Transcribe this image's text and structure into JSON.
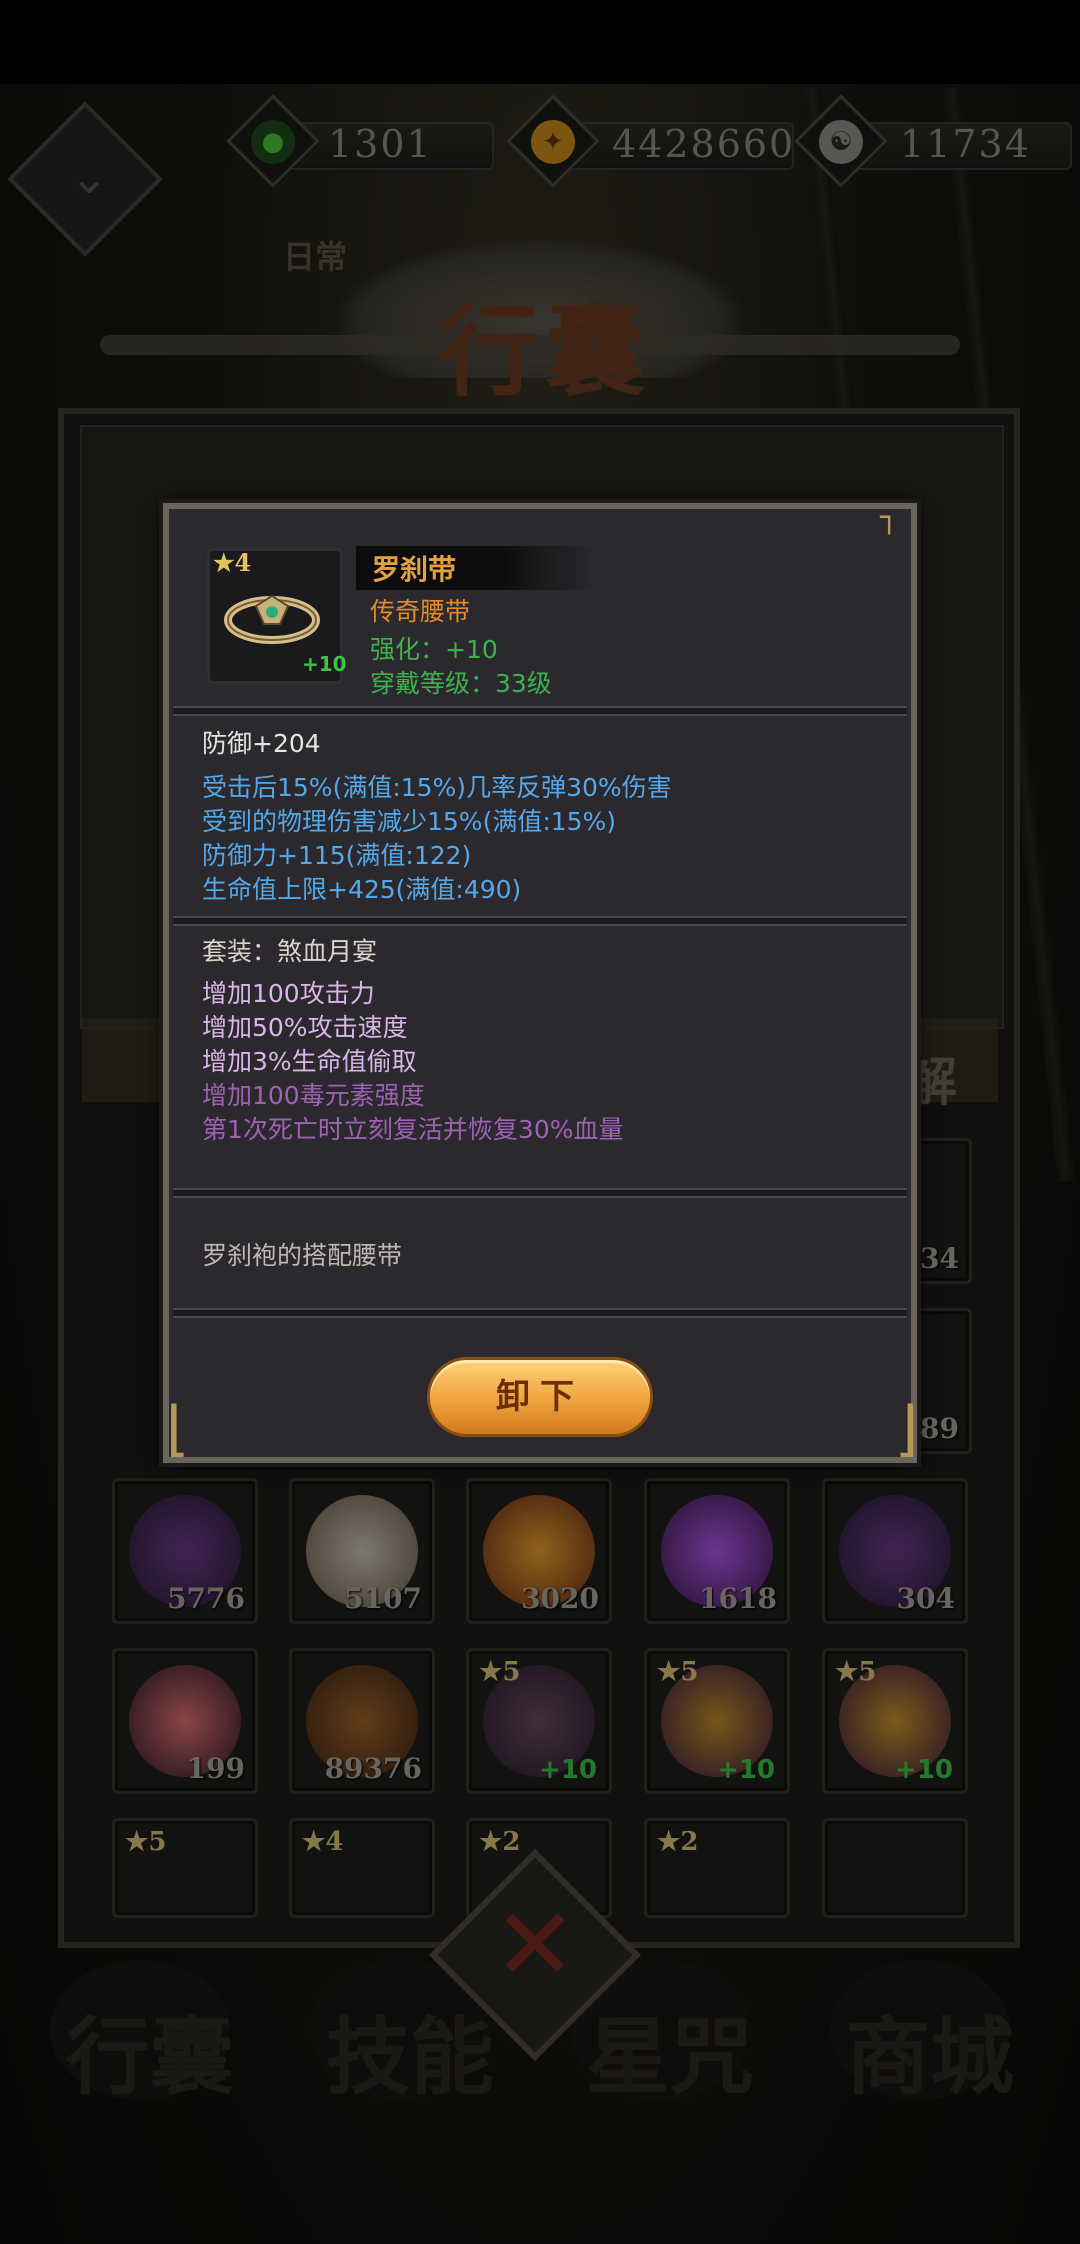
{
  "currency": [
    {
      "name": "green-leaf",
      "value": "1301"
    },
    {
      "name": "gold-coin",
      "value": "4428660"
    },
    {
      "name": "silver-yin-yang",
      "value": "11734"
    }
  ],
  "header": {
    "title": "行囊",
    "daily_tab": "日常"
  },
  "bag": {
    "decompose_label": "解",
    "rows": [
      [
        {
          "qty": "5776"
        },
        {
          "qty": "5107"
        },
        {
          "qty": "3020"
        },
        {
          "qty": "1618"
        },
        {
          "qty": "304"
        }
      ],
      [
        {
          "qty": "199"
        },
        {
          "qty": "89376"
        },
        {
          "star": "5",
          "plus": "+10"
        },
        {
          "star": "5",
          "plus": "+10"
        },
        {
          "star": "5",
          "plus": "+10"
        }
      ],
      [
        {
          "star": "5"
        },
        {
          "star": "4"
        },
        {
          "star": "2"
        },
        {
          "star": "2"
        },
        {}
      ]
    ],
    "partial_qty": [
      "34",
      "89"
    ]
  },
  "bottom_nav": [
    "行囊",
    "技能",
    "星咒",
    "商城"
  ],
  "popup": {
    "item": {
      "star": "4",
      "plus": "+10",
      "name": "罗刹带",
      "type": "传奇腰带",
      "enhance": "强化：+10",
      "level_req": "穿戴等级：33级"
    },
    "base_stat": "防御+204",
    "extra_stats": [
      "受击后15%(满值:15%)几率反弹30%伤害",
      "受到的物理伤害减少15%(满值:15%)",
      "防御力+115(满值:122)",
      "生命值上限+425(满值:490)"
    ],
    "set": {
      "title": "套装：煞血月宴",
      "active": [
        "增加100攻击力",
        "增加50%攻击速度",
        "增加3%生命值偷取"
      ],
      "inactive": [
        "增加100毒元素强度",
        "第1次死亡时立刻复活并恢复30%血量"
      ]
    },
    "description": "罗刹袍的搭配腰带",
    "unequip_label": "卸下"
  },
  "colors": {
    "name": "#e3a142",
    "type": "#e38a2a",
    "green": "#3cb24a",
    "blue_stat": "#55a8e8",
    "set_active": "#d9b6e8",
    "set_inactive": "#9d62b3",
    "button": "#f0a23c"
  },
  "icons": [
    "back-chevron-icon",
    "close-x-icon",
    "star-icon",
    "belt-icon"
  ]
}
